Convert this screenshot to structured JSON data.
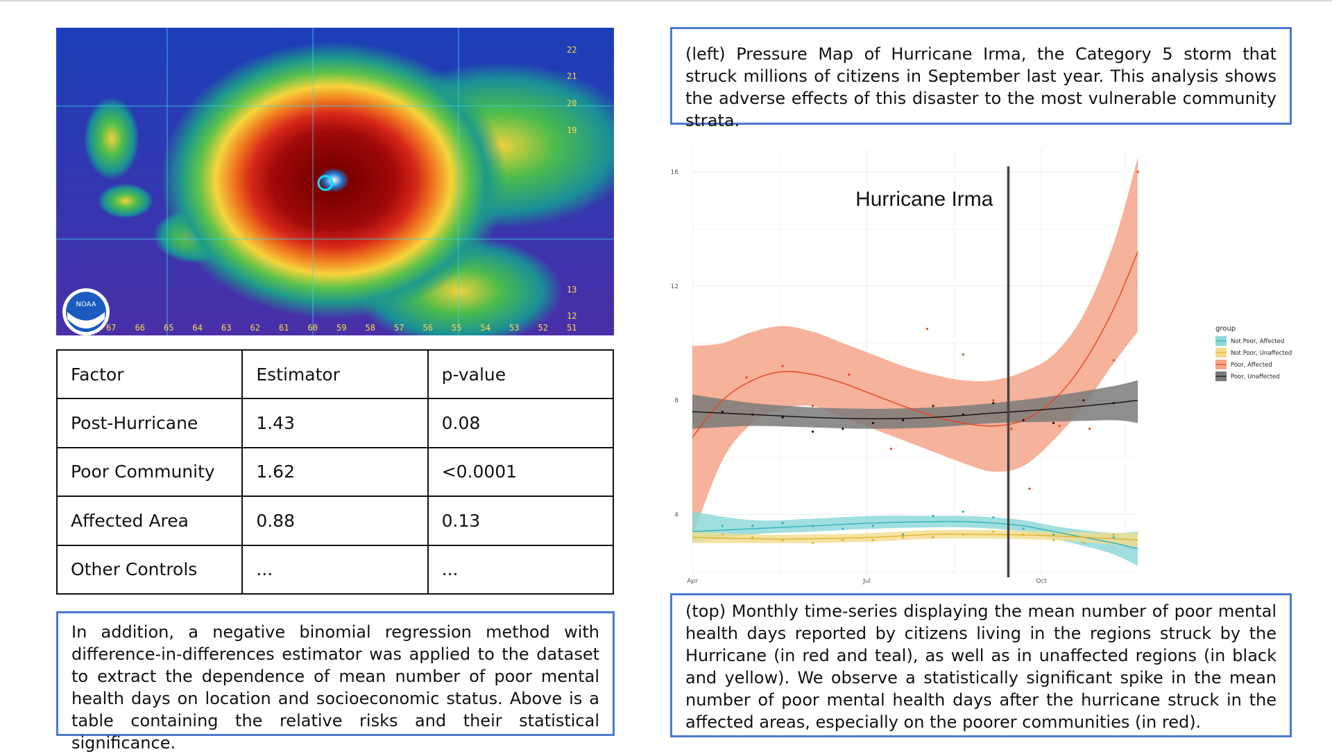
{
  "map": {
    "logo_text": "NOAA",
    "lat_labels": [
      "22",
      "21",
      "20",
      "19",
      "13",
      "12"
    ],
    "lon_labels": [
      "67",
      "66",
      "65",
      "64",
      "63",
      "62",
      "61",
      "60",
      "59",
      "58",
      "57",
      "56",
      "55",
      "54",
      "53",
      "52",
      "51"
    ]
  },
  "table": {
    "rows": [
      [
        "Factor",
        "Estimator",
        "p-value"
      ],
      [
        "Post-Hurricane",
        "1.43",
        "0.08"
      ],
      [
        "Poor Community",
        "1.62",
        "<0.0001"
      ],
      [
        "Affected Area",
        "0.88",
        "0.13"
      ],
      [
        "Other Controls",
        "...",
        "..."
      ]
    ]
  },
  "captions": {
    "left_bottom": "In addition, a negative binomial regression method with difference-in-differences estimator was applied to the dataset to extract the dependence of mean number of poor mental health days on location and socioeconomic status. Above is a table containing the relative risks and their statistical significance.",
    "right_top": "(left) Pressure Map of Hurricane Irma, the Category 5 storm that struck millions of citizens in September last year. This analysis shows the adverse effects of this disaster to the most vulnerable community strata.",
    "right_bottom": "(top) Monthly time-series displaying the mean number of poor mental health days reported by citizens living in the regions struck by the Hurricane (in red and teal), as well as in unaffected regions (in black and yellow). We observe a statistically significant spike in the mean number of poor mental health days after the hurricane struck in the affected areas, especially on the poorer communities (in red)."
  },
  "colors": {
    "caption_border": "#4a78d0",
    "poor_affected": "#e8431e",
    "poor_affected_band": "#f5a48a",
    "poor_unaffected": "#111111",
    "poor_unaffected_band": "#7a7a7a",
    "not_poor_affected": "#2ab3b8",
    "not_poor_affected_band": "#8fd8da",
    "not_poor_unaffected": "#e3b22a",
    "not_poor_unaffected_band": "#f2dc8c"
  },
  "chart_data": {
    "type": "line",
    "title": "",
    "xlabel": "",
    "ylabel": "",
    "x_ticks": [
      "Apr",
      "Jul",
      "Oct"
    ],
    "y_ticks": [
      4,
      8,
      12,
      16
    ],
    "xlim": [
      0,
      7.4
    ],
    "ylim": [
      1.8,
      16.8
    ],
    "grid": true,
    "annotation": {
      "text": "Hurricane Irma",
      "x": 5.25
    },
    "legend": {
      "title": "group",
      "position": "right",
      "entries": [
        "Not Poor, Affected",
        "Not Poor, Unaffected",
        "Poor, Affected",
        "Poor, Unaffected"
      ]
    },
    "series": [
      {
        "name": "Poor, Affected",
        "x": [
          0,
          0.5,
          1,
          1.5,
          2,
          2.5,
          3,
          3.5,
          4,
          4.5,
          5,
          5.5,
          6,
          6.5,
          7,
          7.4
        ],
        "y": [
          6.7,
          8.0,
          8.7,
          9.0,
          8.9,
          8.6,
          8.2,
          7.8,
          7.45,
          7.2,
          7.1,
          7.3,
          8.0,
          9.3,
          11.2,
          13.2
        ],
        "lower": [
          3.2,
          5.9,
          7.2,
          7.7,
          7.8,
          7.4,
          7.0,
          6.6,
          6.2,
          5.8,
          5.5,
          5.7,
          6.6,
          7.8,
          9.3,
          10.4
        ],
        "upper": [
          9.9,
          10.0,
          10.4,
          10.6,
          10.4,
          10.0,
          9.6,
          9.2,
          8.9,
          8.7,
          8.7,
          9.0,
          9.6,
          11.0,
          13.5,
          16.5
        ],
        "points": [
          [
            0.9,
            8.8
          ],
          [
            1.5,
            9.2
          ],
          [
            2.0,
            7.8
          ],
          [
            2.6,
            8.9
          ],
          [
            3.3,
            6.3
          ],
          [
            3.9,
            10.5
          ],
          [
            4.5,
            9.6
          ],
          [
            5.0,
            8.0
          ],
          [
            5.3,
            7.0
          ],
          [
            5.6,
            4.9
          ],
          [
            6.1,
            7.1
          ],
          [
            6.6,
            7.0
          ],
          [
            7.0,
            9.4
          ],
          [
            7.4,
            16.0
          ]
        ]
      },
      {
        "name": "Poor, Unaffected",
        "x": [
          0,
          1,
          2,
          3,
          4,
          5,
          6,
          7,
          7.4
        ],
        "y": [
          7.6,
          7.5,
          7.4,
          7.35,
          7.4,
          7.55,
          7.7,
          7.9,
          8.0
        ],
        "lower": [
          7.0,
          7.1,
          7.05,
          7.0,
          7.05,
          7.2,
          7.25,
          7.3,
          7.2
        ],
        "upper": [
          8.2,
          7.9,
          7.75,
          7.7,
          7.75,
          7.9,
          8.15,
          8.5,
          8.7
        ],
        "points": [
          [
            0.5,
            7.6
          ],
          [
            1.0,
            7.5
          ],
          [
            1.5,
            7.4
          ],
          [
            2.0,
            6.9
          ],
          [
            2.5,
            7.0
          ],
          [
            3.0,
            7.2
          ],
          [
            3.5,
            7.3
          ],
          [
            4.0,
            7.8
          ],
          [
            4.5,
            7.5
          ],
          [
            5.0,
            7.9
          ],
          [
            5.5,
            7.3
          ],
          [
            6.0,
            7.2
          ],
          [
            6.5,
            8.0
          ],
          [
            7.0,
            7.9
          ]
        ]
      },
      {
        "name": "Not Poor, Affected",
        "x": [
          0,
          1,
          2,
          3,
          4,
          4.5,
          5,
          5.5,
          6,
          6.5,
          7,
          7.4
        ],
        "y": [
          3.4,
          3.5,
          3.6,
          3.7,
          3.75,
          3.75,
          3.7,
          3.6,
          3.4,
          3.2,
          3.0,
          2.8
        ],
        "lower": [
          3.0,
          3.3,
          3.4,
          3.5,
          3.55,
          3.55,
          3.5,
          3.4,
          3.15,
          2.9,
          2.6,
          2.2
        ],
        "upper": [
          4.1,
          3.8,
          3.85,
          3.95,
          3.95,
          3.95,
          3.9,
          3.8,
          3.6,
          3.45,
          3.35,
          3.4
        ],
        "points": [
          [
            0.5,
            3.6
          ],
          [
            1.0,
            3.6
          ],
          [
            1.5,
            3.7
          ],
          [
            2.0,
            3.6
          ],
          [
            2.5,
            3.5
          ],
          [
            3.0,
            3.6
          ],
          [
            3.5,
            3.3
          ],
          [
            4.0,
            3.95
          ],
          [
            4.5,
            4.1
          ],
          [
            5.0,
            3.9
          ],
          [
            5.5,
            3.5
          ],
          [
            6.0,
            3.3
          ],
          [
            6.5,
            3.0
          ],
          [
            7.0,
            3.2
          ]
        ]
      },
      {
        "name": "Not Poor, Unaffected",
        "x": [
          0,
          1,
          2,
          3,
          4,
          5,
          6,
          7,
          7.4
        ],
        "y": [
          3.2,
          3.15,
          3.15,
          3.2,
          3.3,
          3.3,
          3.25,
          3.15,
          3.1
        ],
        "lower": [
          3.0,
          3.0,
          3.0,
          3.05,
          3.15,
          3.15,
          3.1,
          2.95,
          2.85
        ],
        "upper": [
          3.4,
          3.3,
          3.3,
          3.35,
          3.45,
          3.45,
          3.4,
          3.35,
          3.35
        ],
        "points": [
          [
            0.5,
            3.3
          ],
          [
            1.0,
            3.2
          ],
          [
            1.5,
            3.1
          ],
          [
            2.0,
            3.0
          ],
          [
            2.5,
            3.1
          ],
          [
            3.0,
            3.1
          ],
          [
            3.5,
            3.2
          ],
          [
            4.0,
            3.2
          ],
          [
            4.5,
            3.3
          ],
          [
            5.0,
            3.4
          ],
          [
            5.5,
            3.3
          ],
          [
            6.0,
            3.1
          ],
          [
            6.5,
            3.0
          ],
          [
            7.0,
            3.3
          ]
        ]
      }
    ]
  }
}
